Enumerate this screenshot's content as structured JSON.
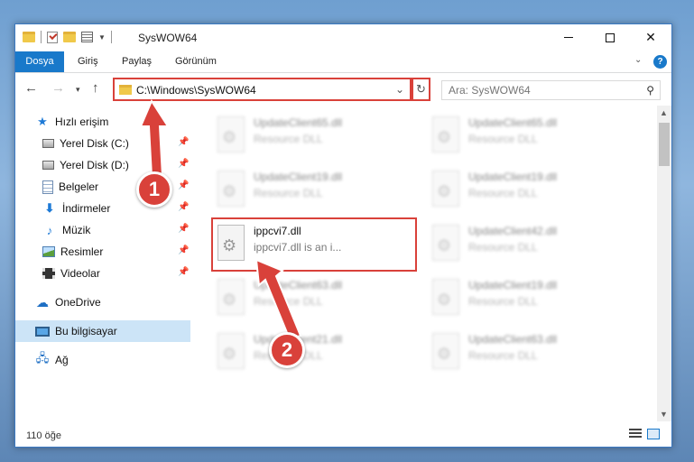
{
  "window": {
    "title": "SysWOW64",
    "controls": {
      "minimize": "—",
      "maximize": "☐",
      "close": "✕"
    }
  },
  "ribbon": {
    "tabs": [
      {
        "label": "Dosya"
      },
      {
        "label": "Giriş"
      },
      {
        "label": "Paylaş"
      },
      {
        "label": "Görünüm"
      }
    ],
    "help": "?"
  },
  "navigation": {
    "address_path": "C:\\Windows\\SysWOW64",
    "search_placeholder": "Ara: SysWOW64"
  },
  "sidebar": {
    "items": [
      {
        "label": "Hızlı erişim",
        "icon": "star-icon"
      },
      {
        "label": "Yerel Disk (C:)",
        "icon": "drive-icon",
        "pinned": true
      },
      {
        "label": "Yerel Disk (D:)",
        "icon": "drive-icon",
        "pinned": true
      },
      {
        "label": "Belgeler",
        "icon": "documents-icon",
        "pinned": true
      },
      {
        "label": "İndirmeler",
        "icon": "downloads-icon",
        "pinned": true
      },
      {
        "label": "Müzik",
        "icon": "music-icon",
        "pinned": true
      },
      {
        "label": "Resimler",
        "icon": "pictures-icon",
        "pinned": true
      },
      {
        "label": "Videolar",
        "icon": "videos-icon",
        "pinned": true
      },
      {
        "label": "OneDrive",
        "icon": "onedrive-icon"
      },
      {
        "label": "Bu bilgisayar",
        "icon": "this-pc-icon",
        "selected": true
      },
      {
        "label": "Ağ",
        "icon": "network-icon"
      }
    ]
  },
  "files": [
    {
      "name": "UpdateClient65.dll",
      "desc": "Resource DLL"
    },
    {
      "name": "UpdateClient65.dll",
      "desc": "Resource DLL"
    },
    {
      "name": "UpdateClient19.dll",
      "desc": "Resource DLL"
    },
    {
      "name": "UpdateClient19.dll",
      "desc": "Resource DLL"
    },
    {
      "name": "ippcvi7.dll",
      "desc": "ippcvi7.dll is an i..."
    },
    {
      "name": "UpdateClient42.dll",
      "desc": "Resource DLL"
    },
    {
      "name": "UpdateClient63.dll",
      "desc": "Resource DLL"
    },
    {
      "name": "UpdateClient19.dll",
      "desc": "Resource DLL"
    },
    {
      "name": "UpdateClient21.dll",
      "desc": "Resource DLL"
    },
    {
      "name": "UpdateClient63.dll",
      "desc": "Resource DLL"
    }
  ],
  "status": {
    "item_count": "110 öğe"
  },
  "annotations": {
    "step1": "1",
    "step2": "2",
    "color": "#d9413a"
  }
}
